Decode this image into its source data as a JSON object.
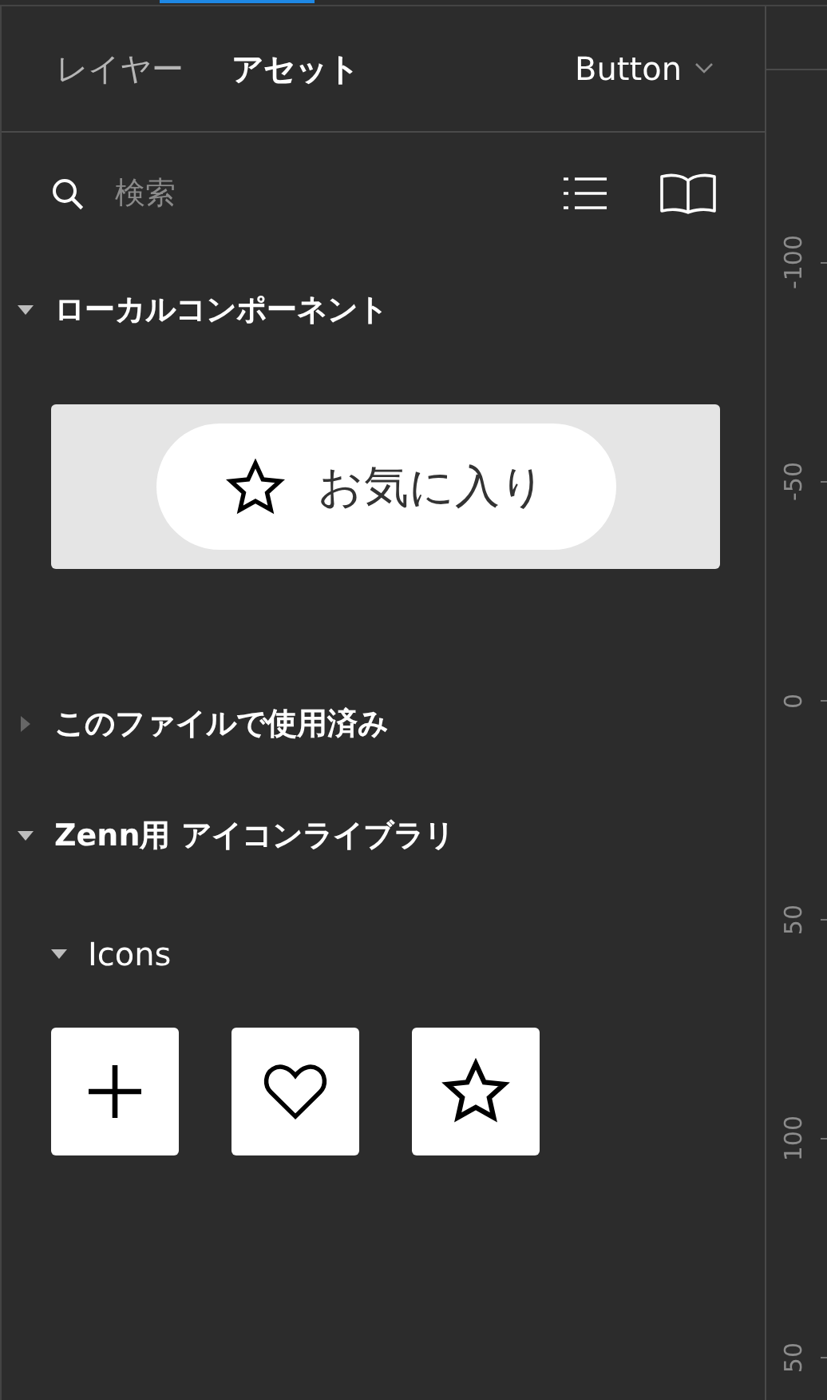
{
  "tabs": [
    {
      "label": "レイヤー",
      "selected": false
    },
    {
      "label": "アセット",
      "selected": true
    }
  ],
  "page_dropdown": {
    "label": "Button"
  },
  "search": {
    "placeholder": "検索"
  },
  "sections": [
    {
      "title": "ローカルコンポーネント",
      "expanded": true,
      "components": [
        {
          "label": "お気に入り",
          "kind": "star"
        }
      ]
    },
    {
      "title": "このファイルで使用済み",
      "expanded": false
    },
    {
      "title": "Zenn用 アイコンライブラリ",
      "expanded": true,
      "groups": [
        {
          "title": "Icons",
          "expanded": true,
          "icons": [
            {
              "kind": "plus"
            },
            {
              "kind": "heart"
            },
            {
              "kind": "star"
            }
          ]
        }
      ]
    }
  ],
  "ruler": {
    "labels": [
      "-100",
      "-50",
      "0",
      "50",
      "100",
      "50"
    ]
  }
}
